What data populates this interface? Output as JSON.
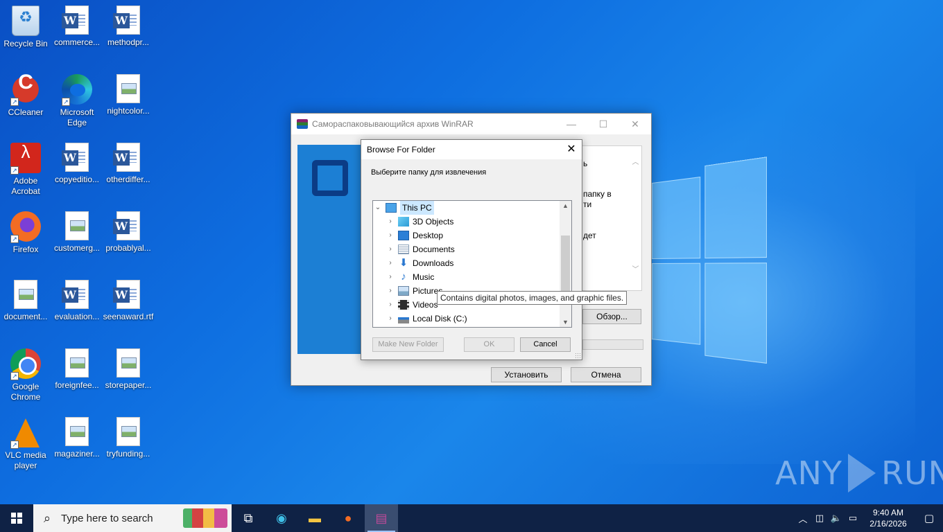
{
  "desktop": {
    "icons": [
      {
        "label": "Recycle Bin",
        "type": "recycle-bin-icon"
      },
      {
        "label": "commerce...",
        "type": "word-document-icon"
      },
      {
        "label": "methodpr...",
        "type": "word-document-icon"
      },
      {
        "label": "CCleaner",
        "type": "ccleaner-icon"
      },
      {
        "label": "Microsoft Edge",
        "type": "edge-icon"
      },
      {
        "label": "nightcolor...",
        "type": "image-file-icon"
      },
      {
        "label": "Adobe Acrobat",
        "type": "acrobat-icon"
      },
      {
        "label": "copyeditio...",
        "type": "word-document-icon"
      },
      {
        "label": "otherdiffer...",
        "type": "word-document-icon"
      },
      {
        "label": "Firefox",
        "type": "firefox-icon"
      },
      {
        "label": "customerg...",
        "type": "image-file-icon"
      },
      {
        "label": "probablyal...",
        "type": "word-document-icon"
      },
      {
        "label": "document...",
        "type": "image-file-icon"
      },
      {
        "label": "evaluation...",
        "type": "word-document-icon"
      },
      {
        "label": "seenaward.rtf",
        "type": "word-document-icon"
      },
      {
        "label": "Google Chrome",
        "type": "chrome-icon"
      },
      {
        "label": "foreignfee...",
        "type": "image-file-icon"
      },
      {
        "label": "storepaper...",
        "type": "image-file-icon"
      },
      {
        "label": "VLC media player",
        "type": "vlc-icon"
      },
      {
        "label": "magaziner...",
        "type": "image-file-icon"
      },
      {
        "label": "tryfunding...",
        "type": "image-file-icon"
      }
    ]
  },
  "winrar": {
    "title": "Самораспаковывающийся архив WinRAR",
    "minimize": "—",
    "maximize": "☐",
    "close": "✕",
    "text_lines": [
      "ь",
      "папку в",
      "ти",
      "дет"
    ],
    "browse_button": "Обзор...",
    "install_button": "Установить",
    "cancel_button": "Отмена"
  },
  "browse_dialog": {
    "title": "Browse For Folder",
    "close": "✕",
    "prompt": "Выберите папку для извлечения",
    "tree": [
      {
        "label": "This PC",
        "icon": "computer-icon",
        "level": 0,
        "expanded": true,
        "selected": true
      },
      {
        "label": "3D Objects",
        "icon": "3d-objects-icon",
        "level": 1
      },
      {
        "label": "Desktop",
        "icon": "desktop-folder-icon",
        "level": 1
      },
      {
        "label": "Documents",
        "icon": "documents-icon",
        "level": 1
      },
      {
        "label": "Downloads",
        "icon": "downloads-icon",
        "level": 1
      },
      {
        "label": "Music",
        "icon": "music-icon",
        "level": 1
      },
      {
        "label": "Pictures",
        "icon": "pictures-icon",
        "level": 1
      },
      {
        "label": "Videos",
        "icon": "videos-icon",
        "level": 1
      },
      {
        "label": "Local Disk (C:)",
        "icon": "local-disk-icon",
        "level": 1
      }
    ],
    "make_new_folder": "Make New Folder",
    "ok": "OK",
    "cancel": "Cancel",
    "tooltip": "Contains digital photos, images, and graphic files."
  },
  "taskbar": {
    "search_placeholder": "Type here to search",
    "clock_time": "9:40 AM",
    "clock_date": "2/16/2026"
  },
  "watermark": {
    "left": "ANY",
    "right": "RUN"
  }
}
